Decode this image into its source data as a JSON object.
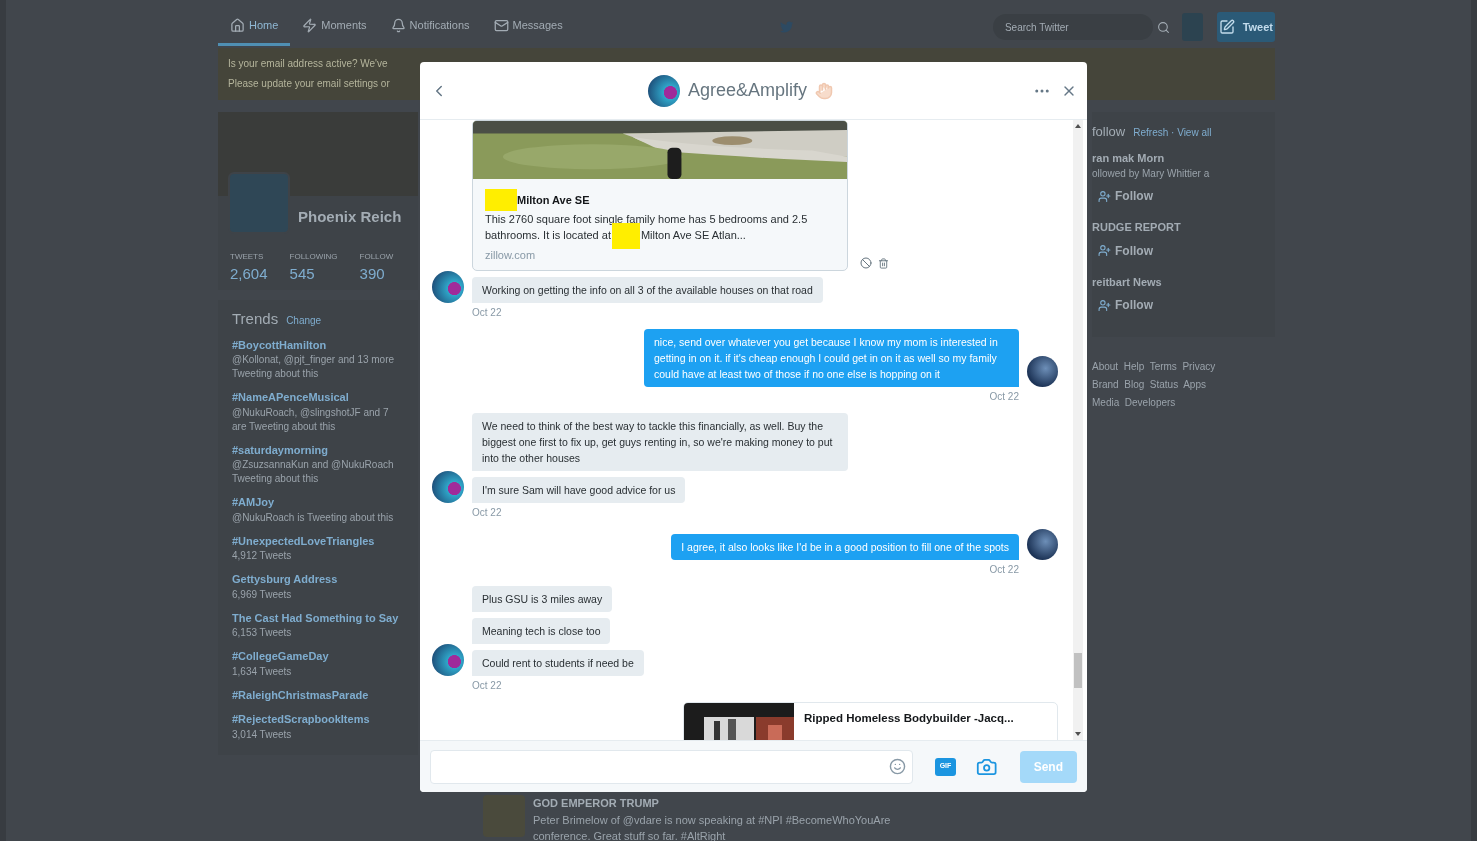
{
  "nav": {
    "tabs": [
      {
        "label": "Home",
        "selected": true
      },
      {
        "label": "Moments",
        "selected": false
      },
      {
        "label": "Notifications",
        "selected": false
      },
      {
        "label": "Messages",
        "selected": false
      }
    ],
    "search": {
      "placeholder": "Search Twitter"
    },
    "tweet_button": "Tweet"
  },
  "banner": {
    "lines": [
      "Is your email address active? We've",
      "Please update your email settings or"
    ]
  },
  "profile": {
    "name": "Phoenix Reich",
    "stats": [
      {
        "label": "TWEETS",
        "value": "2,604"
      },
      {
        "label": "FOLLOWING",
        "value": "545"
      },
      {
        "label": "FOLLOW",
        "value": "390"
      }
    ]
  },
  "trends": {
    "title": "Trends",
    "change": "Change",
    "items": [
      {
        "name": "#BoycottHamilton",
        "details": [
          "@Kollonat, @pjt_finger and 13 more",
          "Tweeting about this"
        ]
      },
      {
        "name": "#NameAPenceMusical",
        "details": [
          "@NukuRoach, @slingshotJF and 7",
          "are Tweeting about this"
        ]
      },
      {
        "name": "#saturdaymorning",
        "details": [
          "@ZsuzsannaKun and @NukuRoach",
          "Tweeting about this"
        ]
      },
      {
        "name": "#AMJoy",
        "details": [
          "@NukuRoach is Tweeting about this"
        ]
      },
      {
        "name": "#UnexpectedLoveTriangles",
        "details": [
          "4,912 Tweets"
        ]
      },
      {
        "name": "Gettysburg Address",
        "details": [
          "6,969 Tweets"
        ]
      },
      {
        "name": "The Cast Had Something to Say",
        "details": [
          "6,153 Tweets"
        ]
      },
      {
        "name": "#CollegeGameDay",
        "details": [
          "1,634 Tweets"
        ]
      },
      {
        "name": "#RaleighChristmasParade"
      },
      {
        "name": "#RejectedScrapbookItems",
        "details": [
          "3,014 Tweets"
        ]
      }
    ]
  },
  "who_to_follow": {
    "title": "follow",
    "actions": "Refresh · View all",
    "items": [
      {
        "name": "ran mak Morn",
        "note": "ollowed by Mary Whittier a",
        "follow": "Follow"
      },
      {
        "name": "RUDGE REPORT",
        "follow": "Follow"
      },
      {
        "name": "reitbart News",
        "follow": "Follow"
      }
    ]
  },
  "footer": {
    "lines": [
      "About  Help  Terms  Privacy",
      "Brand  Blog  Status  Apps",
      "Media  Developers"
    ]
  },
  "timeline_tweet": {
    "author": "GOD EMPEROR TRUMP",
    "lines": [
      "Peter Brimelow of @vdare is now speaking at #NPI #BecomeWhoYouAre",
      "conference. Great stuff so far. #AltRight"
    ]
  },
  "conversation": {
    "title": "Agree&Amplify",
    "groups": [
      {
        "kind": "received",
        "time": "Oct 22",
        "items": [
          {
            "kind": "link_card",
            "title": "Milton Ave SE",
            "description_before": "This 2760 square foot single family home has 5 bedrooms and 2.5 bathrooms. It is located at",
            "description_after": "Milton Ave SE Atlan...",
            "domain": "zillow.com"
          },
          {
            "kind": "text",
            "text": "Working on getting the info on all 3 of the available houses on that road"
          }
        ]
      },
      {
        "kind": "sent",
        "time": "Oct 22",
        "items": [
          {
            "kind": "text",
            "text": "nice, send over whatever you get because I know my mom is interested in getting in on it. if it's cheap enough I could get in on it as well so my family could have at least two of those if no one else is hopping on it"
          }
        ]
      },
      {
        "kind": "received",
        "time": "Oct 22",
        "items": [
          {
            "kind": "text",
            "text": "We need to think of the best way to tackle this financially, as well. Buy the biggest one first to fix up, get guys renting in, so we're making money to put into the other houses"
          },
          {
            "kind": "text",
            "text": "I'm sure Sam will have good advice for us"
          }
        ]
      },
      {
        "kind": "sent",
        "time": "Oct 22",
        "items": [
          {
            "kind": "text",
            "text": "I agree, it also looks like I'd be in a good position to fill one of the spots"
          }
        ]
      },
      {
        "kind": "received",
        "time": "Oct 22",
        "items": [
          {
            "kind": "text",
            "text": "Plus GSU is 3 miles away"
          },
          {
            "kind": "text",
            "text": "Meaning tech is close too"
          },
          {
            "kind": "text",
            "text": "Could rent to students if need be"
          }
        ]
      },
      {
        "kind": "sent",
        "items": [
          {
            "kind": "thumb_card",
            "title": "Ripped Homeless Bodybuilder -Jacq..."
          }
        ]
      }
    ]
  },
  "composer": {
    "gif_label": "GIF",
    "send": "Send",
    "send_disabled": true
  }
}
